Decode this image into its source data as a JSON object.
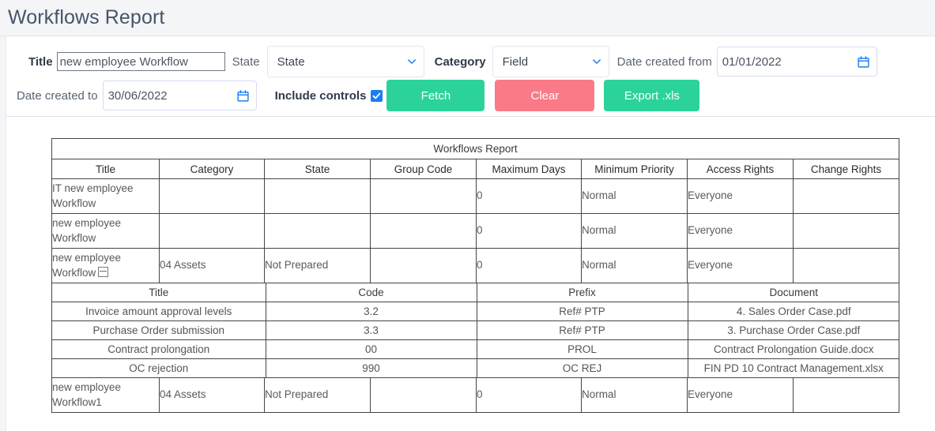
{
  "header": {
    "title": "Workflows Report"
  },
  "filters": {
    "title_label": "Title",
    "title_value": "new employee Workflow",
    "state_label": "State",
    "state_value": "State",
    "category_label": "Category",
    "category_value": "Field",
    "date_from_label": "Date created from",
    "date_from_value": "01/01/2022",
    "date_to_label": "Date created to",
    "date_to_value": "30/06/2022",
    "include_controls_label": "Include controls",
    "include_controls_checked": true,
    "fetch_label": "Fetch",
    "clear_label": "Clear",
    "export_label": "Export .xls",
    "colors": {
      "fetch": "#2bd39a",
      "clear": "#fa7a88",
      "export": "#2bd39a",
      "checkbox": "#1a7ef0",
      "icon_blue": "#1a7ef0",
      "title_text": "#46546b"
    }
  },
  "report": {
    "caption": "Workflows Report",
    "columns": [
      "Title",
      "Category",
      "State",
      "Group Code",
      "Maximum Days",
      "Minimum Priority",
      "Access Rights",
      "Change Rights"
    ],
    "rows": [
      {
        "title": "IT new employee Workflow",
        "category": "",
        "state": "",
        "group_code": "",
        "maximum_days": "0",
        "minimum_priority": "Normal",
        "access_rights": "Everyone",
        "change_rights": "",
        "has_collapse_icon": false
      },
      {
        "title": "new employee Workflow",
        "category": "",
        "state": "",
        "group_code": "",
        "maximum_days": "0",
        "minimum_priority": "Normal",
        "access_rights": "Everyone",
        "change_rights": "",
        "has_collapse_icon": false
      },
      {
        "title": "new employee Workflow",
        "category": "04 Assets",
        "state": "Not Prepared",
        "group_code": "",
        "maximum_days": "0",
        "minimum_priority": "Normal",
        "access_rights": "Everyone",
        "change_rights": "",
        "has_collapse_icon": true
      },
      {
        "title": "new employee Workflow1",
        "category": "04 Assets",
        "state": "Not Prepared",
        "group_code": "",
        "maximum_days": "0",
        "minimum_priority": "Normal",
        "access_rights": "Everyone",
        "change_rights": "",
        "has_collapse_icon": false
      }
    ],
    "subtable": {
      "columns": [
        "Title",
        "Code",
        "Prefix",
        "Document"
      ],
      "rows": [
        {
          "title": "Invoice amount approval levels",
          "code": "3.2",
          "prefix": "Ref# PTP",
          "document": "4. Sales Order Case.pdf"
        },
        {
          "title": "Purchase Order submission",
          "code": "3.3",
          "prefix": "Ref# PTP",
          "document": "3. Purchase Order Case.pdf"
        },
        {
          "title": "Contract prolongation",
          "code": "00",
          "prefix": "PROL",
          "document": "Contract Prolongation Guide.docx"
        },
        {
          "title": "OC rejection",
          "code": "990",
          "prefix": "OC REJ",
          "document": "FIN PD 10 Contract Management.xlsx"
        }
      ]
    }
  }
}
